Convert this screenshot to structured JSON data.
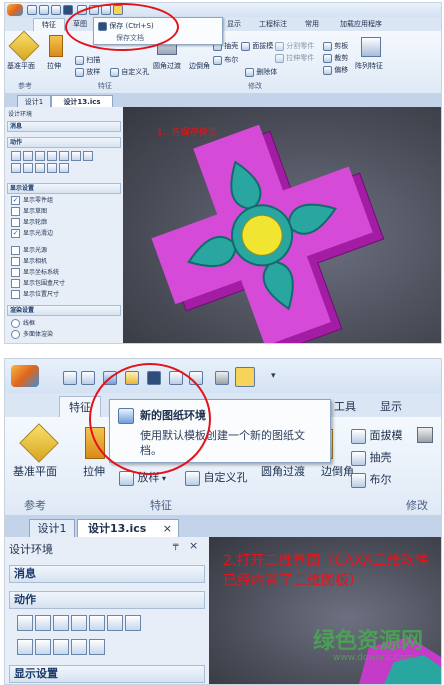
{
  "panel1": {
    "qat_icons": [
      "new-icon",
      "open-icon",
      "save-icon",
      "undo-icon",
      "redo-icon",
      "cube-icon",
      "layer-icon"
    ],
    "tabs": [
      "特征",
      "草图",
      "显示",
      "工程标注",
      "常用",
      "加载应用程序"
    ],
    "save_menu": {
      "save": "保存 (Ctrl+S)",
      "save_doc": "保存文档"
    },
    "ribbon": {
      "base_plane": "基准平面",
      "extrude": "拉伸",
      "sweep": "扫描",
      "loft": "放样",
      "hole": "自定义孔",
      "fillet": "圆角过渡",
      "chamfer": "边倒角",
      "shell": "抽壳",
      "bool": "布尔",
      "face_draft": "面拔模",
      "split": "分割零件",
      "stretch": "拉伸零件",
      "delete_body": "删除体",
      "cut": "剪板",
      "trim": "裁剪",
      "offset": "偏移",
      "array": "阵列特征"
    },
    "groups": {
      "ref": "参考",
      "feature": "特征",
      "modify": "修改"
    },
    "doc_tabs": [
      "设计1",
      "设计13.ics"
    ],
    "left_title": "设计环境",
    "sections": {
      "message": "消息",
      "action": "动作",
      "display": "显示设置",
      "render": "渲染设置"
    },
    "display_checks": [
      "显示零件组",
      "显示草图",
      "显示轮廓",
      "显示光滑边"
    ],
    "display_unchecks": [
      "显示光源",
      "显示相机",
      "显示坐标系统",
      "显示包围盒尺寸",
      "显示位置尺寸"
    ],
    "render_options": [
      "线框",
      "多面体渲染"
    ],
    "annotation": "1、先保存模型"
  },
  "panel2": {
    "qat_icons": [
      "new-icon",
      "check-icon",
      "drawing-icon",
      "open-icon",
      "save-icon",
      "undo-icon",
      "redo-icon",
      "cube-icon",
      "grid-icon",
      "more-icon"
    ],
    "tabs": [
      "特征",
      "工具",
      "显示"
    ],
    "tooltip": {
      "title": "新的图纸环境",
      "desc": "使用默认模板创建一个新的图纸文档。"
    },
    "ribbon": {
      "base_plane": "基准平面",
      "extrude": "拉伸",
      "loft": "放样",
      "hole": "自定义孔",
      "fillet": "圆角过渡",
      "chamfer": "边倒角",
      "face_draft": "面拔模",
      "shell": "抽壳",
      "bool": "布尔"
    },
    "groups": {
      "ref": "参考",
      "feature": "特征",
      "modify": "修改"
    },
    "doc_tabs": [
      "设计1",
      "设计13.ics"
    ],
    "left_title": "设计环境",
    "sections": {
      "message": "消息",
      "action": "动作",
      "display": "显示设置"
    },
    "annotation": "2.打开二维界面（CAXA三维软件已经内置了二维图板）",
    "watermark": "绿色资源网",
    "watermark_url": "www.downcc.com"
  }
}
